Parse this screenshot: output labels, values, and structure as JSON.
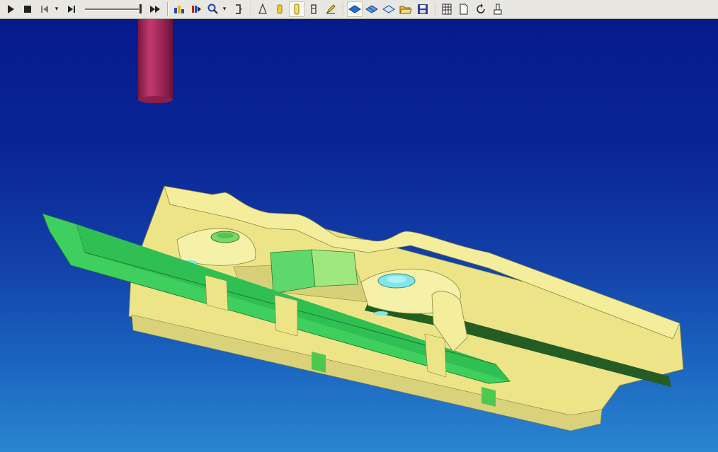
{
  "toolbar": {
    "buttons": [
      {
        "icon": "play-icon",
        "pressed": false
      },
      {
        "icon": "stop-icon",
        "pressed": false
      },
      {
        "icon": "step-back-icon",
        "pressed": false
      },
      {
        "icon": "dropdown-arrow-icon",
        "pressed": false
      },
      {
        "icon": "step-forward-icon",
        "pressed": false
      },
      {
        "icon": "fast-forward-icon",
        "pressed": false
      },
      {
        "icon": "toolpath-icon",
        "pressed": false
      },
      {
        "icon": "color-icon",
        "pressed": false
      },
      {
        "icon": "zoom-icon",
        "pressed": false
      },
      {
        "icon": "fit-view-icon",
        "pressed": false
      },
      {
        "icon": "tool-cone-icon",
        "pressed": false
      },
      {
        "icon": "tool-shaded-icon",
        "pressed": false
      },
      {
        "icon": "tool-solid-icon",
        "pressed": true
      },
      {
        "icon": "tool-holder-icon",
        "pressed": false
      },
      {
        "icon": "pencil-icon",
        "pressed": false
      },
      {
        "icon": "shaded-stock-icon",
        "pressed": true
      },
      {
        "icon": "wire-stock-icon",
        "pressed": false
      },
      {
        "icon": "transparent-stock-icon",
        "pressed": false
      },
      {
        "icon": "open-folder-icon",
        "pressed": false
      },
      {
        "icon": "save-icon",
        "pressed": false
      },
      {
        "icon": "grid-icon",
        "pressed": false
      },
      {
        "icon": "document-icon",
        "pressed": false
      },
      {
        "icon": "refresh-icon",
        "pressed": false
      },
      {
        "icon": "report-icon",
        "pressed": false
      }
    ],
    "slider_value": 1.0
  },
  "viewport": {
    "background_top": "#061a8e",
    "background_bottom": "#2a86cf",
    "tool_color": "#a8285a",
    "part_yellow": "#f0e98a",
    "part_green": "#3fcf5e",
    "part_cyan": "#7fe6ea"
  }
}
